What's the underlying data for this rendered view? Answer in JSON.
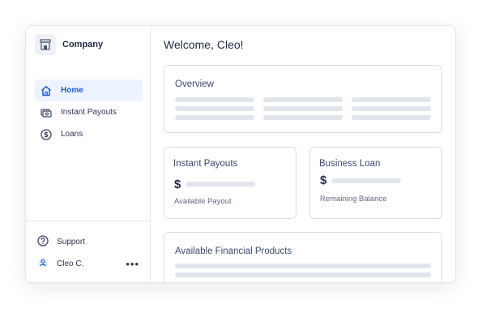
{
  "company": {
    "name": "Company",
    "logo_icon": "storefront-icon"
  },
  "nav": {
    "items": [
      {
        "label": "Home",
        "icon": "home-icon",
        "active": true
      },
      {
        "label": "Instant Payouts",
        "icon": "cash-icon",
        "active": false
      },
      {
        "label": "Loans",
        "icon": "dollar-circle-icon",
        "active": false
      }
    ]
  },
  "footer": {
    "support_label": "Support",
    "support_icon": "help-circle-icon",
    "user_name": "Cleo C.",
    "user_icon": "user-icon",
    "more_label": "•••"
  },
  "main": {
    "welcome": "Welcome, Cleo!",
    "overview": {
      "title": "Overview"
    },
    "payouts": {
      "title": "Instant Payouts",
      "currency": "$",
      "caption": "Available Payout"
    },
    "loan": {
      "title": "Business Loan",
      "currency": "$",
      "caption": "Remaining Balance"
    },
    "products": {
      "title": "Available Financial Products"
    }
  },
  "colors": {
    "accent": "#1e5bd8",
    "active_bg": "#eef4ff",
    "placeholder_bar": "#e1e6ee",
    "border": "#d8dde6"
  }
}
